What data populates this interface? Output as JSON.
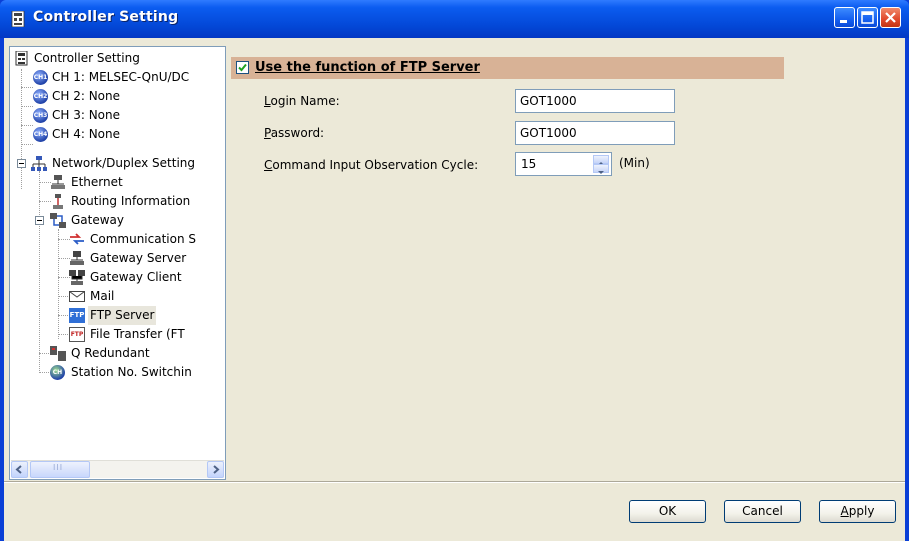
{
  "window": {
    "title": "Controller Setting",
    "accent": "#0a3fd6"
  },
  "tree": {
    "items": [
      {
        "label": "Controller Setting",
        "icon": "controller-icon"
      },
      {
        "label": "CH 1: MELSEC-QnU/DC",
        "icon": "ch1-icon",
        "badge": "CH1"
      },
      {
        "label": "CH 2: None",
        "icon": "ch2-icon",
        "badge": "CH2"
      },
      {
        "label": "CH 3: None",
        "icon": "ch3-icon",
        "badge": "CH3"
      },
      {
        "label": "CH 4: None",
        "icon": "ch4-icon",
        "badge": "CH4"
      },
      {
        "label": "Network/Duplex Setting",
        "icon": "network-icon"
      },
      {
        "label": "Ethernet",
        "icon": "ethernet-icon"
      },
      {
        "label": "Routing Information",
        "icon": "routing-icon"
      },
      {
        "label": "Gateway",
        "icon": "gateway-icon"
      },
      {
        "label": "Communication S",
        "icon": "communication-icon"
      },
      {
        "label": "Gateway Server",
        "icon": "gateway-server-icon"
      },
      {
        "label": "Gateway Client",
        "icon": "gateway-client-icon"
      },
      {
        "label": "Mail",
        "icon": "mail-icon"
      },
      {
        "label": "FTP Server",
        "icon": "ftp-server-icon",
        "badge": "FTP"
      },
      {
        "label": "File Transfer (FT",
        "icon": "file-transfer-icon",
        "badge": "FTP"
      },
      {
        "label": "Q Redundant",
        "icon": "q-redundant-icon"
      },
      {
        "label": "Station No. Switchin",
        "icon": "station-switch-icon",
        "badge": "CH"
      }
    ],
    "scroll_thumb_label": "III"
  },
  "ftp": {
    "use_label": "Use the function of FTP Server",
    "use_checked": true,
    "login_label_u": "L",
    "login_label_rest": "ogin Name:",
    "login_value": "GOT1000",
    "password_label_u": "P",
    "password_label_rest": "assword:",
    "password_value": "GOT1000",
    "cycle_label_u": "C",
    "cycle_label_rest": "ommand Input Observation Cycle:",
    "cycle_value": "15",
    "cycle_unit": "(Min)"
  },
  "buttons": {
    "ok": "OK",
    "cancel": "Cancel",
    "apply_u": "A",
    "apply_rest": "pply"
  }
}
